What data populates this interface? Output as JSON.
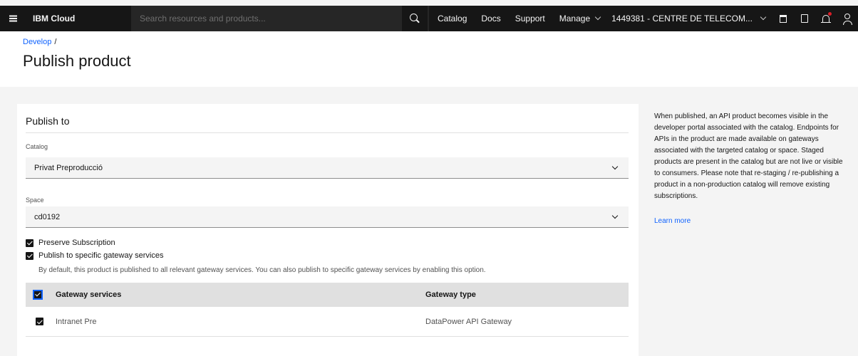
{
  "topbar": {
    "brand": "IBM Cloud",
    "search_placeholder": "Search resources and products...",
    "nav": [
      "Catalog",
      "Docs",
      "Support"
    ],
    "manage": "Manage",
    "account": "1449381 - CENTRE DE TELECOM..."
  },
  "header": {
    "breadcrumb": "Develop",
    "breadcrumb_sep": "/",
    "title": "Publish product"
  },
  "form": {
    "section_title": "Publish to",
    "catalog_label": "Catalog",
    "catalog_value": "Privat Preproducció",
    "space_label": "Space",
    "space_value": "cd0192",
    "preserve_label": "Preserve Subscription",
    "publish_specific_label": "Publish to specific gateway services",
    "helper_text": "By default, this product is published to all relevant gateway services. You can also publish to specific gateway services by enabling this option."
  },
  "table": {
    "headers": [
      "Gateway services",
      "Gateway type"
    ],
    "rows": [
      {
        "service": "Intranet Pre",
        "type": "DataPower API Gateway"
      }
    ]
  },
  "side": {
    "description": "When published, an API product becomes visible in the developer portal associated with the catalog. Endpoints for APIs in the product are made available on gateways associated with the targeted catalog or space. Staged products are present in the catalog but are not live or visible to consumers. Please note that re-staging / re-publishing a product in a non-production catalog will remove existing subscriptions.",
    "learn_more": "Learn more"
  },
  "colors": {
    "topbar_bg": "#161616",
    "link": "#0f62fe",
    "notification_dot": "#da1e28"
  }
}
